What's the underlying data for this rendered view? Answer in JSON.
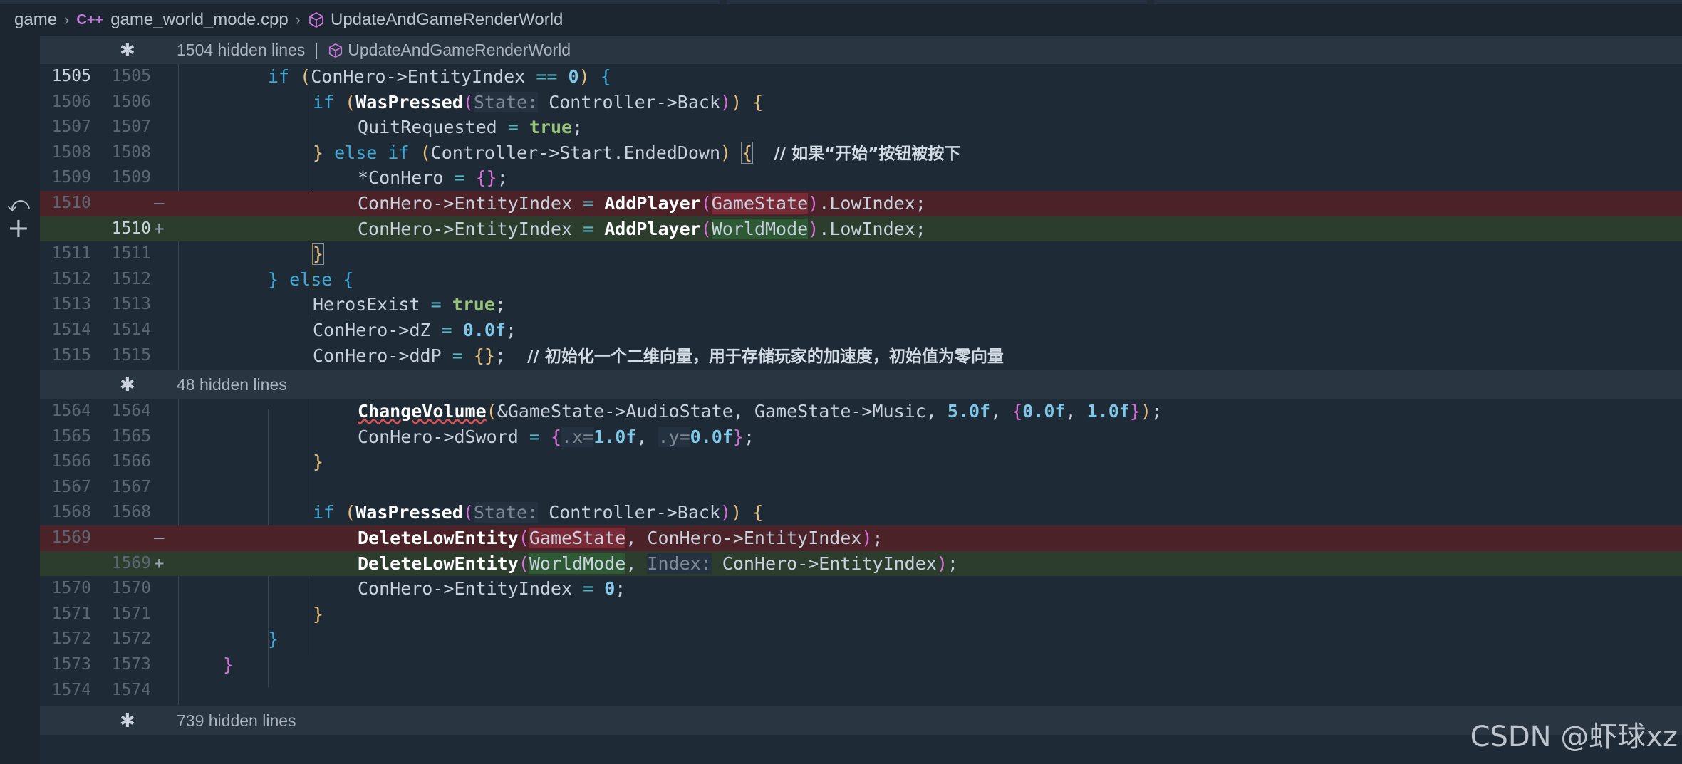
{
  "breadcrumb": {
    "folder": "game",
    "file_badge": "C++",
    "file": "game_world_mode.cpp",
    "symbol": "UpdateAndGameRenderWorld"
  },
  "folds": {
    "top": {
      "text": "1504 hidden lines",
      "separator": "|",
      "symbol": "UpdateAndGameRenderWorld"
    },
    "middle": {
      "text": "48 hidden lines"
    },
    "bottom": {
      "text": "739 hidden lines"
    }
  },
  "lines": [
    {
      "old": "1505",
      "new": "1505"
    },
    {
      "old": "1506",
      "new": "1506"
    },
    {
      "old": "1507",
      "new": "1507"
    },
    {
      "old": "1508",
      "new": "1508"
    },
    {
      "old": "1509",
      "new": "1509"
    },
    {
      "old": "1510",
      "new": "",
      "mark": "—"
    },
    {
      "old": "",
      "new": "1510",
      "mark": "+"
    },
    {
      "old": "1511",
      "new": "1511"
    },
    {
      "old": "1512",
      "new": "1512"
    },
    {
      "old": "1513",
      "new": "1513"
    },
    {
      "old": "1514",
      "new": "1514"
    },
    {
      "old": "1515",
      "new": "1515"
    },
    {
      "old": "1564",
      "new": "1564"
    },
    {
      "old": "1565",
      "new": "1565"
    },
    {
      "old": "1566",
      "new": "1566"
    },
    {
      "old": "1567",
      "new": "1567"
    },
    {
      "old": "1568",
      "new": "1568"
    },
    {
      "old": "1569",
      "new": "",
      "mark": "—"
    },
    {
      "old": "",
      "new": "1569",
      "mark": "+"
    },
    {
      "old": "1570",
      "new": "1570"
    },
    {
      "old": "1571",
      "new": "1571"
    },
    {
      "old": "1572",
      "new": "1572"
    },
    {
      "old": "1573",
      "new": "1573"
    },
    {
      "old": "1574",
      "new": "1574"
    }
  ],
  "tokens": {
    "if": "if",
    "else": "else",
    "true": "true",
    "conhero_entityindex": "ConHero->EntityIndex",
    "eq": "==",
    "assign": "=",
    "zero": "0",
    "waspressed": "WasPressed",
    "hint_state": "State:",
    "controller_back": "Controller->Back",
    "quit": "QuitRequested",
    "controller_start": "Controller->Start.EndedDown",
    "comment1": "// 如果“开始”按钮被按下",
    "star_conhero": "*ConHero",
    "addplayer": "AddPlayer",
    "gamestate": "GameState",
    "worldmode": "WorldMode",
    "lowindex": ".LowIndex;",
    "herosexist": "HerosExist",
    "conhero_dz": "ConHero->dZ",
    "f00": "0.0",
    "f": "f",
    "conhero_ddp": "ConHero->ddP",
    "comment2": "// 初始化一个二维向量，用于存储玩家的加速度，初始值为零向量",
    "changevolume": "ChangeVolume",
    "audiostate": "GameState->AudioState",
    "music": "GameState->Music",
    "f50": "5.0",
    "f10": "1.0",
    "conhero_dsword": "ConHero->dSword",
    "hint_x": ".x=",
    "hint_y": ".y=",
    "deletelowentity": "DeleteLowEntity",
    "hint_index": "Index:"
  },
  "side": {
    "revert_icon": "⤺",
    "add_icon": "+"
  },
  "watermark": "CSDN @虾球xz"
}
